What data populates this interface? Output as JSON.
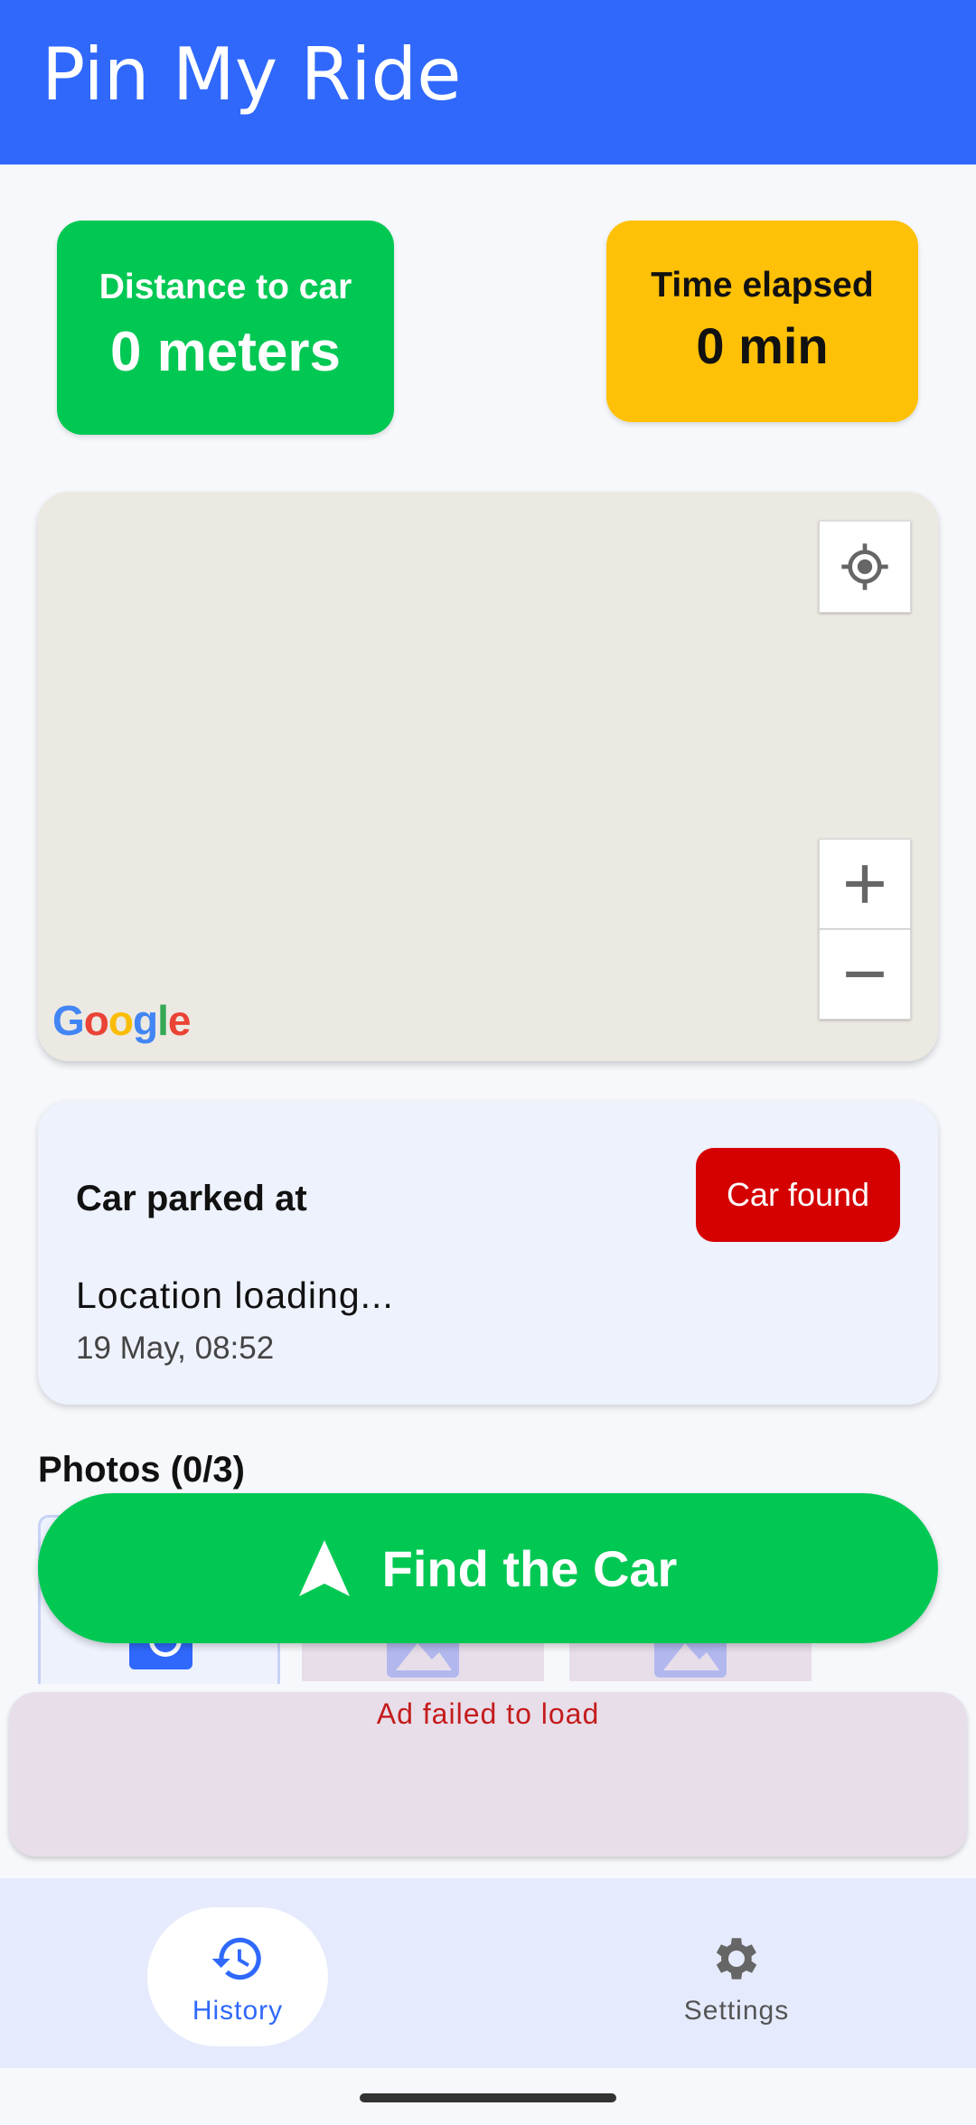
{
  "appbar": {
    "title": "Pin My Ride"
  },
  "stats": {
    "distance": {
      "label": "Distance to car",
      "value": "0 meters",
      "color": "#00c853"
    },
    "time": {
      "label": "Time elapsed",
      "value": "0 min",
      "color": "#ffc107"
    }
  },
  "map": {
    "logo": "Google",
    "locate_icon": "my-location-icon",
    "zoom_in_icon": "plus-icon",
    "zoom_out_icon": "minus-icon"
  },
  "parking": {
    "heading": "Car parked at",
    "car_found_label": "Car found",
    "location": "Location loading...",
    "datetime": "19 May, 08:52"
  },
  "photos": {
    "title": "Photos (0/3)"
  },
  "find_button": {
    "label": "Find the Car",
    "icon": "navigation-arrow-icon"
  },
  "ad": {
    "message": "Ad failed to load"
  },
  "bottom_nav": {
    "items": [
      {
        "label": "History",
        "icon": "history-icon",
        "selected": true
      },
      {
        "label": "Settings",
        "icon": "gear-icon",
        "selected": false
      }
    ]
  },
  "colors": {
    "primary": "#2f68fb",
    "success": "#00c853",
    "warning": "#ffc107",
    "danger": "#d50000"
  }
}
